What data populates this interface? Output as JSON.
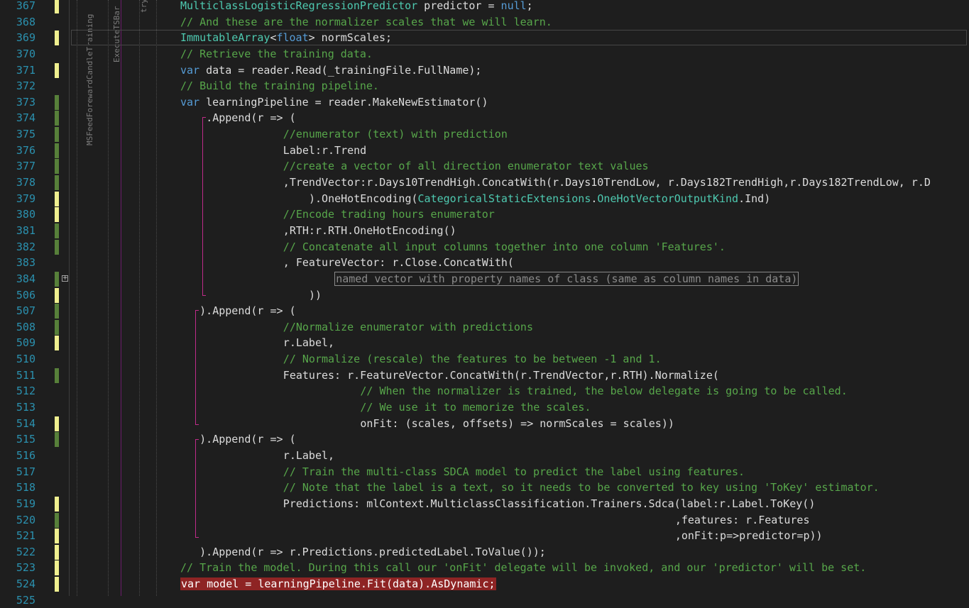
{
  "colors": {
    "background": "#1e1e1e",
    "line_number": "#2b91af",
    "comment": "#57a64a",
    "keyword": "#569cd6",
    "type": "#4ec9b0",
    "text": "#dcdcdc",
    "change_saved": "#57803a",
    "change_unsaved": "#efef8f",
    "breakpoint_highlight": "#8e2424",
    "scope_brace": "#c02c8a"
  },
  "scope_labels": {
    "method": "MSFeedForewardCandleTraining",
    "inner": "ExecuteTSBar",
    "block": "try"
  },
  "fold_toggle_symbol": "+",
  "lines": [
    {
      "num": "367",
      "indent": 0,
      "change": "unsaved",
      "tokens": [
        {
          "t": "MulticlassLogisticRegressionPredictor",
          "c": "type"
        },
        {
          "t": " predictor = ",
          "c": "plain"
        },
        {
          "t": "null",
          "c": "keyword"
        },
        {
          "t": ";",
          "c": "plain"
        }
      ]
    },
    {
      "num": "368",
      "indent": 0,
      "change": "",
      "tokens": [
        {
          "t": "// And these are the normalizer scales that we will learn.",
          "c": "comment"
        }
      ]
    },
    {
      "num": "369",
      "indent": 0,
      "change": "unsaved",
      "tokens": [
        {
          "t": "ImmutableArray",
          "c": "type"
        },
        {
          "t": "<",
          "c": "plain"
        },
        {
          "t": "float",
          "c": "keyword"
        },
        {
          "t": "> normScales;",
          "c": "plain"
        }
      ]
    },
    {
      "num": "370",
      "indent": 0,
      "change": "",
      "tokens": [
        {
          "t": "// Retrieve the training data.",
          "c": "comment"
        }
      ]
    },
    {
      "num": "371",
      "indent": 0,
      "change": "unsaved",
      "tokens": [
        {
          "t": "var",
          "c": "keyword"
        },
        {
          "t": " data = reader.Read(_trainingFile.FullName);",
          "c": "plain"
        }
      ]
    },
    {
      "num": "372",
      "indent": 0,
      "change": "",
      "tokens": [
        {
          "t": "// Build the training pipeline.",
          "c": "comment"
        }
      ]
    },
    {
      "num": "373",
      "indent": 0,
      "change": "saved",
      "tokens": [
        {
          "t": "var",
          "c": "keyword"
        },
        {
          "t": " learningPipeline = reader.MakeNewEstimator()",
          "c": "plain"
        }
      ]
    },
    {
      "num": "374",
      "indent": 4,
      "change": "saved",
      "tokens": [
        {
          "t": ".Append(r => (",
          "c": "plain"
        }
      ]
    },
    {
      "num": "375",
      "indent": 16,
      "change": "saved",
      "tokens": [
        {
          "t": "//enumerator (text) with prediction",
          "c": "comment"
        }
      ]
    },
    {
      "num": "376",
      "indent": 16,
      "change": "saved",
      "tokens": [
        {
          "t": "Label:r.Trend",
          "c": "plain"
        }
      ]
    },
    {
      "num": "377",
      "indent": 16,
      "change": "saved",
      "tokens": [
        {
          "t": "//create a vector of all direction enumerator text values",
          "c": "comment"
        }
      ]
    },
    {
      "num": "378",
      "indent": 16,
      "change": "saved",
      "tokens": [
        {
          "t": ",TrendVector:r.Days10TrendHigh.ConcatWith(r.Days10TrendLow, r.Days182TrendHigh,r.Days182TrendLow, r.D",
          "c": "plain"
        }
      ]
    },
    {
      "num": "379",
      "indent": 20,
      "change": "unsaved",
      "tokens": [
        {
          "t": ").OneHotEncoding(",
          "c": "plain"
        },
        {
          "t": "CategoricalStaticExtensions",
          "c": "type"
        },
        {
          "t": ".",
          "c": "plain"
        },
        {
          "t": "OneHotVectorOutputKind",
          "c": "type"
        },
        {
          "t": ".Ind)",
          "c": "plain"
        }
      ]
    },
    {
      "num": "380",
      "indent": 16,
      "change": "unsaved",
      "tokens": [
        {
          "t": "//Encode trading hours enumerator",
          "c": "comment"
        }
      ]
    },
    {
      "num": "381",
      "indent": 16,
      "change": "saved",
      "tokens": [
        {
          "t": ",RTH:r.RTH.OneHotEncoding()",
          "c": "plain"
        }
      ]
    },
    {
      "num": "382",
      "indent": 16,
      "change": "saved",
      "tokens": [
        {
          "t": "// Concatenate all input columns together into one column 'Features'.",
          "c": "comment"
        }
      ]
    },
    {
      "num": "383",
      "indent": 16,
      "change": "",
      "tokens": [
        {
          "t": ", FeatureVector: r.Close.ConcatWith(",
          "c": "plain"
        }
      ]
    },
    {
      "num": "384",
      "indent": 24,
      "change": "saved",
      "tokens": [
        {
          "t": "named vector with property names of class (same as column names in data)",
          "c": "collapsed"
        }
      ]
    },
    {
      "num": "506",
      "indent": 20,
      "change": "unsaved",
      "tokens": [
        {
          "t": "))",
          "c": "plain"
        }
      ]
    },
    {
      "num": "507",
      "indent": 3,
      "change": "saved",
      "tokens": [
        {
          "t": ").Append(r => (",
          "c": "plain"
        }
      ]
    },
    {
      "num": "508",
      "indent": 16,
      "change": "saved",
      "tokens": [
        {
          "t": "//Normalize enumerator with predictions",
          "c": "comment"
        }
      ]
    },
    {
      "num": "509",
      "indent": 16,
      "change": "unsaved",
      "tokens": [
        {
          "t": "r.Label,",
          "c": "plain"
        }
      ]
    },
    {
      "num": "510",
      "indent": 16,
      "change": "",
      "tokens": [
        {
          "t": "// Normalize (rescale) the features to be between -1 and 1.",
          "c": "comment"
        }
      ]
    },
    {
      "num": "511",
      "indent": 16,
      "change": "saved",
      "tokens": [
        {
          "t": "Features: r.FeatureVector.ConcatWith(r.TrendVector,r.RTH).Normalize(",
          "c": "plain"
        }
      ]
    },
    {
      "num": "512",
      "indent": 28,
      "change": "",
      "tokens": [
        {
          "t": "// When the normalizer is trained, the below delegate is going to be called.",
          "c": "comment"
        }
      ]
    },
    {
      "num": "513",
      "indent": 28,
      "change": "",
      "tokens": [
        {
          "t": "// We use it to memorize the scales.",
          "c": "comment"
        }
      ]
    },
    {
      "num": "514",
      "indent": 28,
      "change": "unsaved",
      "tokens": [
        {
          "t": "onFit: (scales, offsets) => normScales = scales))",
          "c": "plain"
        }
      ]
    },
    {
      "num": "515",
      "indent": 3,
      "change": "saved",
      "tokens": [
        {
          "t": ").Append(r => (",
          "c": "plain"
        }
      ]
    },
    {
      "num": "516",
      "indent": 16,
      "change": "",
      "tokens": [
        {
          "t": "r.Label,",
          "c": "plain"
        }
      ]
    },
    {
      "num": "517",
      "indent": 16,
      "change": "",
      "tokens": [
        {
          "t": "// Train the multi-class SDCA model to predict the label using features.",
          "c": "comment"
        }
      ]
    },
    {
      "num": "518",
      "indent": 16,
      "change": "",
      "tokens": [
        {
          "t": "// Note that the label is a text, so it needs to be converted to key using 'ToKey' estimator.",
          "c": "comment"
        }
      ]
    },
    {
      "num": "519",
      "indent": 16,
      "change": "unsaved",
      "tokens": [
        {
          "t": "Predictions: mlContext.MulticlassClassification.Trainers.Sdca(label:r.Label.ToKey()",
          "c": "plain"
        }
      ]
    },
    {
      "num": "520",
      "indent": 77,
      "change": "saved",
      "tokens": [
        {
          "t": ",features: r.Features",
          "c": "plain"
        }
      ]
    },
    {
      "num": "521",
      "indent": 77,
      "change": "unsaved",
      "tokens": [
        {
          "t": ",onFit:p=>predictor=p))",
          "c": "plain"
        }
      ]
    },
    {
      "num": "522",
      "indent": 3,
      "change": "unsaved",
      "tokens": [
        {
          "t": ").Append(r => r.Predictions.predictedLabel.ToValue());",
          "c": "plain"
        }
      ]
    },
    {
      "num": "523",
      "indent": 0,
      "change": "unsaved",
      "tokens": [
        {
          "t": "// Train the model. During this call our 'onFit' delegate will be invoked, and our 'predictor' will be set.",
          "c": "comment"
        }
      ]
    },
    {
      "num": "524",
      "indent": 0,
      "change": "unsaved",
      "tokens": [
        {
          "t": "var model = learningPipeline.Fit(data).AsDynamic;",
          "c": "highlight"
        }
      ]
    },
    {
      "num": "525",
      "indent": 0,
      "change": "",
      "tokens": []
    }
  ]
}
